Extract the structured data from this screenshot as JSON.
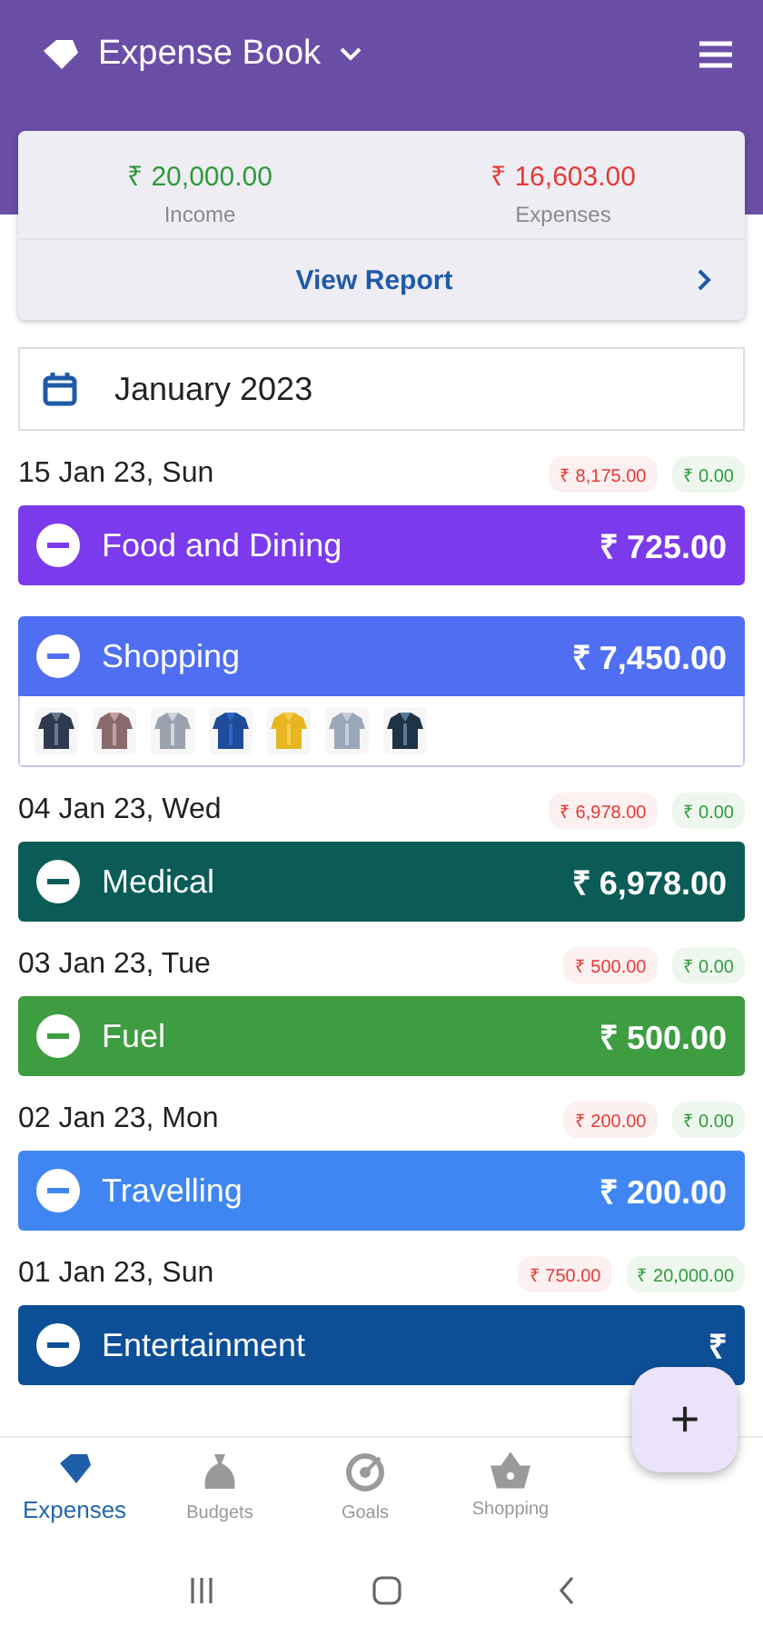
{
  "app_bar": {
    "title": "Expense Book"
  },
  "summary": {
    "income": "₹ 20,000.00",
    "income_label": "Income",
    "expenses": "₹ 16,603.00",
    "expenses_label": "Expenses",
    "report_link": "View Report"
  },
  "month": {
    "value": "January 2023"
  },
  "days": [
    {
      "date": "15 Jan 23, Sun",
      "expense": "₹ 8,175.00",
      "income": "₹ 0.00",
      "entries": [
        {
          "name": "Food and Dining",
          "amount": "₹ 725.00",
          "color": "#7c3aed"
        },
        {
          "name": "Shopping",
          "amount": "₹ 7,450.00",
          "color": "#4f6ef2"
        }
      ]
    },
    {
      "date": "04 Jan 23, Wed",
      "expense": "₹ 6,978.00",
      "income": "₹ 0.00",
      "entries": [
        {
          "name": "Medical",
          "amount": "₹ 6,978.00",
          "color": "#0b5c57"
        }
      ]
    },
    {
      "date": "03 Jan 23, Tue",
      "expense": "₹ 500.00",
      "income": "₹ 0.00",
      "entries": [
        {
          "name": "Fuel",
          "amount": "₹ 500.00",
          "color": "#3e9c41"
        }
      ]
    },
    {
      "date": "02 Jan 23, Mon",
      "expense": "₹ 200.00",
      "income": "₹ 0.00",
      "entries": [
        {
          "name": "Travelling",
          "amount": "₹ 200.00",
          "color": "#3f86f2"
        }
      ]
    },
    {
      "date": "01 Jan 23, Sun",
      "expense": "₹ 750.00",
      "income": "₹ 20,000.00",
      "entries": [
        {
          "name": "Entertainment",
          "amount": "₹",
          "color": "#0d4f97"
        }
      ]
    }
  ],
  "fab": {
    "label": "+"
  },
  "bottom_nav": [
    {
      "kind": "tag",
      "label": "Expenses",
      "selected": true
    },
    {
      "kind": "moneybag",
      "label": "Budgets",
      "selected": false
    },
    {
      "kind": "target",
      "label": "Goals",
      "selected": false
    },
    {
      "kind": "basket",
      "label": "Shopping",
      "selected": false
    }
  ]
}
